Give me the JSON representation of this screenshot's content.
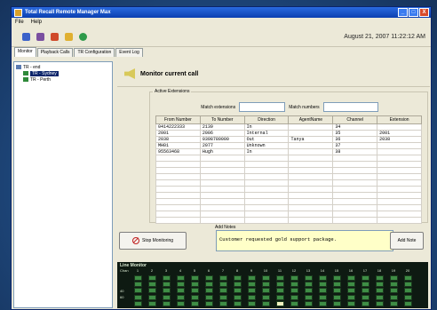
{
  "window": {
    "title": "Total Recall Remote Manager Max",
    "controls": [
      "_",
      "□",
      "X"
    ]
  },
  "menu": [
    "File",
    "Help"
  ],
  "toolbar": {
    "icons": [
      "user-icon",
      "disk-icon",
      "record-icon",
      "tools-icon",
      "globe-icon"
    ],
    "datetime": "August 21, 2007 11:22:12 AM"
  },
  "tabs": [
    "Monitor",
    "Playback Calls",
    "TR Configuration",
    "Event Log"
  ],
  "tree": {
    "nodes": [
      {
        "label": "TR - end",
        "selected": false
      },
      {
        "label": "TR - Sydney",
        "selected": true
      },
      {
        "label": "TR - Perth",
        "selected": false
      }
    ]
  },
  "monitor": {
    "title": "Monitor current call",
    "active_extensions_label": "Active Extensions",
    "match_extensions_label": "Match extensions",
    "match_numbers_label": "Match numbers",
    "columns": [
      "From Number",
      "To Number",
      "Direction",
      "AgentName",
      "Channel",
      "Extension"
    ],
    "rows": [
      [
        "0414222333",
        "2139",
        "In",
        "",
        "34",
        ""
      ],
      [
        "2001",
        "2006",
        "Internal",
        "",
        "35",
        "2001"
      ],
      [
        "2038",
        "0398780000",
        "Out",
        "Tanya",
        "36",
        "2038"
      ],
      [
        "MH01",
        "2077",
        "Unknown",
        "",
        "37",
        ""
      ],
      [
        "95563468",
        "Hugh",
        "In",
        "",
        "38",
        ""
      ]
    ],
    "empty_rows": 11
  },
  "notes": {
    "label": "Add Notes",
    "text": "Customer requested gold support package.",
    "stop_button": "Stop Monitoring",
    "add_button": "Add Note"
  },
  "line_monitor": {
    "title": "Line Monitor",
    "chan_label": "Chan",
    "channels": [
      "1",
      "2",
      "3",
      "4",
      "5",
      "6",
      "7",
      "8",
      "9",
      "10",
      "11",
      "12",
      "13",
      "14",
      "15",
      "16",
      "17",
      "18",
      "19",
      "20"
    ],
    "row_labels": [
      "",
      "",
      "40",
      "60",
      ""
    ],
    "active": [
      [
        4,
        10
      ]
    ]
  }
}
